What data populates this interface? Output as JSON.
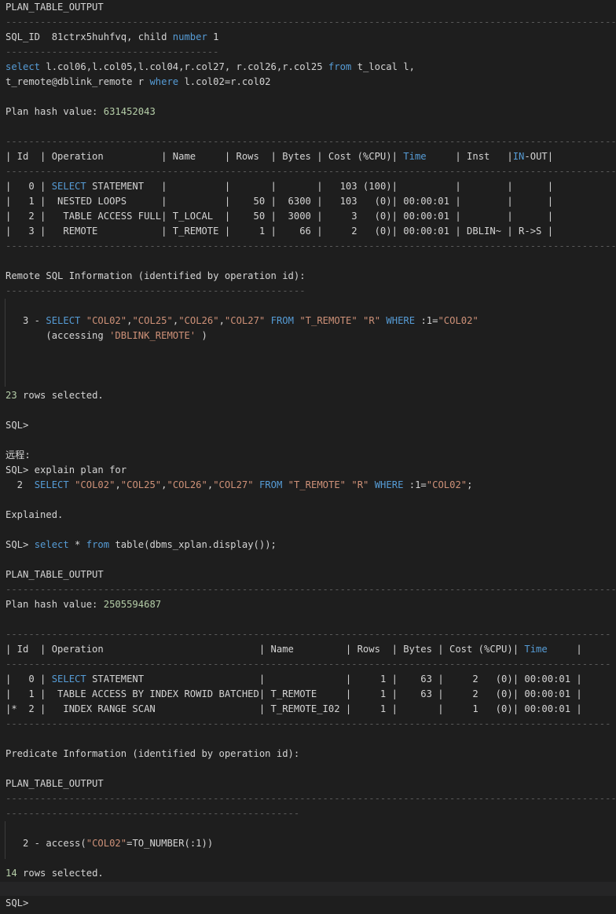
{
  "lines": {
    "plan_output_header": "PLAN_TABLE_OUTPUT",
    "sep_long": "-------------------------------------------------------------------------------------------------------------",
    "sql_id_prefix": "SQL_ID  81ctrx5huhfvq, child ",
    "sql_id_kw": "number",
    "sql_id_num": " 1",
    "sep_short": "-------------------------------------",
    "q_kw_select": "select",
    "q_part1": " l.col06,l.col05,l.col04,r.col27, r.col26,r.col25 ",
    "q_kw_from": "from",
    "q_part2": " t_local l,",
    "q2_part1": "t_remote@dblink_remote r ",
    "q2_kw_where": "where",
    "q2_part2": " l.col02=r.col02",
    "hash1_label": "Plan hash value: ",
    "hash1_value": "631452043",
    "sep_table1": "-------------------------------------------------------------------------------------------------------------",
    "t1_head_a": "| Id  | Operation          | Name     | Rows  | Bytes | Cost (%CPU)| ",
    "t1_head_time": "Time",
    "t1_head_b": "     | Inst   |",
    "t1_head_inout_kw": "IN",
    "t1_head_c": "-OUT|",
    "t1_r0_a": "|   0 | ",
    "t1_r0_kw": "SELECT",
    "t1_r0_b": " STATEMENT   |          |       |       |   103 (100)|          |        |      |",
    "t1_r1": "|   1 |  NESTED LOOPS      |          |    50 |  6300 |   103   (0)| 00:00:01 |        |      |",
    "t1_r2": "|   2 |   TABLE ACCESS FULL| T_LOCAL  |    50 |  3000 |     3   (0)| 00:00:01 |        |      |",
    "t1_r3": "|   3 |   REMOTE           | T_REMOTE |     1 |    66 |     2   (0)| 00:00:01 | DBLIN~ | R->S |",
    "remote_info": "Remote SQL Information (identified by operation id):",
    "sep_remote": "----------------------------------------------------",
    "r3_prefix": "   3 - ",
    "r3_kw_select": "SELECT",
    "r3_s1": "\"COL02\"",
    "r3_c1": ",",
    "r3_s2": "\"COL25\"",
    "r3_c2": ",",
    "r3_s3": "\"COL26\"",
    "r3_c3": ",",
    "r3_s4": "\"COL27\"",
    "r3_kw_from": "FROM",
    "r3_s5": "\"T_REMOTE\"",
    "r3_s6": "\"R\"",
    "r3_kw_where": "WHERE",
    "r3_bind": ":1=",
    "r3_s7": "\"COL02\"",
    "r3_acc_a": "       (accessing ",
    "r3_acc_str": "'DBLINK_REMOTE'",
    "r3_acc_b": " )",
    "rows23_num": "23",
    "rows23_text": " rows selected.",
    "sql_prompt_1": "SQL>",
    "remote_label": "远程:",
    "explain_line": "SQL> explain plan for",
    "e2_prefix": "  2  ",
    "e2_kw_select": "SELECT",
    "e2_s1": "\"COL02\"",
    "e2_c1": ",",
    "e2_s2": "\"COL25\"",
    "e2_c2": ",",
    "e2_s3": "\"COL26\"",
    "e2_c3": ",",
    "e2_s4": "\"COL27\"",
    "e2_kw_from": "FROM",
    "e2_s5": "\"T_REMOTE\"",
    "e2_s6": "\"R\"",
    "e2_kw_where": "WHERE",
    "e2_bind": ":1=",
    "e2_s7": "\"COL02\"",
    "e2_end": ";",
    "explained": "Explained.",
    "disp_prefix": "SQL> ",
    "disp_kw_select": "select",
    "disp_mid": " * ",
    "disp_kw_from": "from",
    "disp_rest": " table(dbms_xplan.display());",
    "plan_output_header_2": "PLAN_TABLE_OUTPUT",
    "sep_long_2": "-------------------------------------------------------------------------------------------------------------",
    "hash2_label": "Plan hash value: ",
    "hash2_value": "2505594687",
    "sep_table2": "---------------------------------------------------------------------------------------------------------",
    "t2_head_a": "| Id  | Operation                           | Name         | Rows  | Bytes | Cost (%CPU)| ",
    "t2_head_time": "Time",
    "t2_head_b": "     |",
    "t2_r0_a": "|   0 | ",
    "t2_r0_kw": "SELECT",
    "t2_r0_b": " STATEMENT                    |              |     1 |    63 |     2   (0)| 00:00:01 |",
    "t2_r1": "|   1 |  TABLE ACCESS BY INDEX ROWID BATCHED| T_REMOTE     |     1 |    63 |     2   (0)| 00:00:01 |",
    "t2_r2": "|*  2 |   INDEX RANGE SCAN                  | T_REMOTE_I02 |     1 |       |     1   (0)| 00:00:01 |",
    "predicate_info": "Predicate Information (identified by operation id):",
    "plan_output_header_3": "PLAN_TABLE_OUTPUT",
    "sep_long_3": "-------------------------------------------------------------------------------------------------------------",
    "sep_pred": "---------------------------------------------------",
    "p2_prefix": "   2 - access(",
    "p2_str": "\"COL02\"",
    "p2_rest": "=TO_NUMBER(:1))",
    "rows14_num": "14",
    "rows14_text": " rows selected.",
    "sql_prompt_2": "SQL>"
  }
}
